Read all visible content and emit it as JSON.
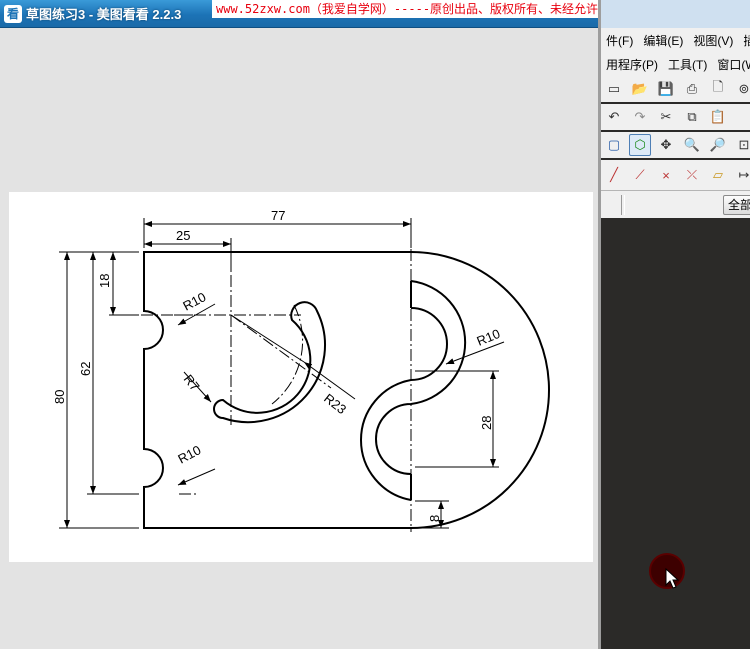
{
  "viewer": {
    "app_icon": "看",
    "title": "草图练习3 - 美图看看 2.2.3",
    "banner": "www.52zxw.com（我爱自学网）-----原创出品、版权所有、未经允许不得转载"
  },
  "drawing": {
    "dims": {
      "d77": "77",
      "d25": "25",
      "d18": "18",
      "d62": "62",
      "d80": "80",
      "r10_top": "R10",
      "r10_bottom": "R10",
      "r10_right": "R10",
      "r7": "R7",
      "r23": "R23",
      "d28": "28",
      "d8": "8"
    }
  },
  "cad": {
    "menu_row1": [
      "件(F)",
      "编辑(E)",
      "视图(V)",
      "插"
    ],
    "menu_row2": [
      "用程序(P)",
      "工具(T)",
      "窗口(W"
    ],
    "all_button": "全部"
  },
  "colors": {
    "titlebar": "#1c73b6",
    "banner_text": "#e8000e",
    "cad_background": "#2b2a28"
  }
}
